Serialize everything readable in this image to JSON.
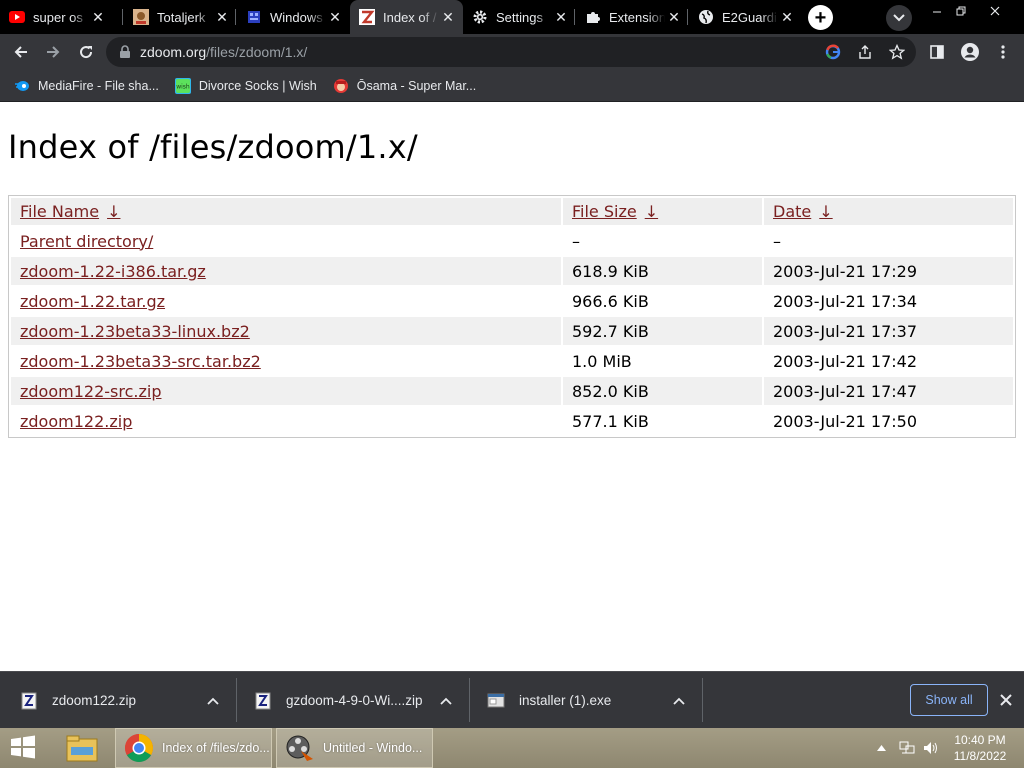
{
  "tabs": [
    {
      "title": "super os",
      "favicon": "youtube-icon",
      "active": false
    },
    {
      "title": "Totaljerk",
      "favicon": "totaljerkface-icon",
      "active": false
    },
    {
      "title": "Windows",
      "favicon": "windows-game-icon",
      "active": false
    },
    {
      "title": "Index of /",
      "favicon": "zdoom-icon",
      "active": true
    },
    {
      "title": "Settings",
      "favicon": "gear-icon",
      "active": false
    },
    {
      "title": "Extension",
      "favicon": "puzzle-icon",
      "active": false
    },
    {
      "title": "E2Guardi",
      "favicon": "globe-icon",
      "active": false
    }
  ],
  "address_bar": {
    "host": "zdoom.org",
    "path": "/files/zdoom/1.x/"
  },
  "bookmarks": [
    {
      "label": "MediaFire - File sha...",
      "icon": "mediafire-icon"
    },
    {
      "label": "Divorce Socks | Wish",
      "icon": "wish-icon"
    },
    {
      "label": "Ōsama - Super Mar...",
      "icon": "mario-icon"
    }
  ],
  "page": {
    "title": "Index of /files/zdoom/1.x/",
    "headers": {
      "name": "File Name",
      "size": "File Size",
      "date": "Date",
      "sort_arrow": "↓"
    },
    "rows": [
      {
        "name": "Parent directory/",
        "size": "–",
        "date": "–"
      },
      {
        "name": "zdoom-1.22-i386.tar.gz",
        "size": "618.9 KiB",
        "date": "2003-Jul-21 17:29"
      },
      {
        "name": "zdoom-1.22.tar.gz",
        "size": "966.6 KiB",
        "date": "2003-Jul-21 17:34"
      },
      {
        "name": "zdoom-1.23beta33-linux.bz2",
        "size": "592.7 KiB",
        "date": "2003-Jul-21 17:37"
      },
      {
        "name": "zdoom-1.23beta33-src.tar.bz2",
        "size": "1.0 MiB",
        "date": "2003-Jul-21 17:42"
      },
      {
        "name": "zdoom122-src.zip",
        "size": "852.0 KiB",
        "date": "2003-Jul-21 17:47"
      },
      {
        "name": "zdoom122.zip",
        "size": "577.1 KiB",
        "date": "2003-Jul-21 17:50"
      }
    ]
  },
  "downloads": {
    "items": [
      {
        "filename": "zdoom122.zip",
        "icon": "zip-file-icon"
      },
      {
        "filename": "gzdoom-4-9-0-Wi....zip",
        "icon": "zip-file-icon"
      },
      {
        "filename": "installer (1).exe",
        "icon": "exe-file-icon"
      }
    ],
    "show_all_label": "Show all"
  },
  "taskbar": {
    "apps": [
      {
        "label": "",
        "icon": "file-explorer-icon"
      },
      {
        "label": "Index of /files/zdo...",
        "icon": "chrome-icon"
      },
      {
        "label": "Untitled - Windo...",
        "icon": "movie-maker-icon"
      }
    ],
    "time": "10:40 PM",
    "date": "11/8/2022"
  },
  "colors": {
    "link": "#7a2020",
    "chrome_dark": "#35363a",
    "tab_strip": "#000000",
    "download_accent": "#8ab4f8",
    "taskbar": "#9c957d"
  }
}
